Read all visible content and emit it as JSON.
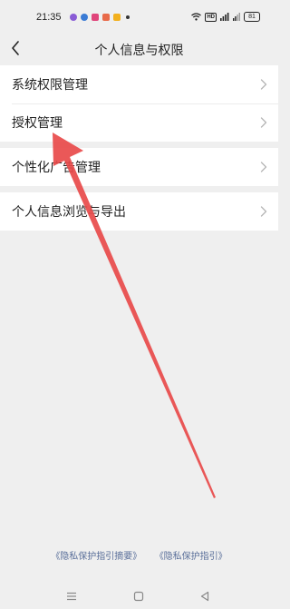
{
  "status_bar": {
    "time": "21:35",
    "hd_label": "HD",
    "battery": "81"
  },
  "header": {
    "title": "个人信息与权限"
  },
  "menu": {
    "items": [
      {
        "label": "系统权限管理"
      },
      {
        "label": "授权管理"
      },
      {
        "label": "个性化广告管理"
      },
      {
        "label": "个人信息浏览与导出"
      }
    ]
  },
  "footer": {
    "link1": "《隐私保护指引摘要》",
    "link2": "《隐私保护指引》"
  },
  "colors": {
    "background": "#efefef",
    "card": "#ffffff",
    "link": "#5a6f9a",
    "annotation_arrow": "#e84a4a"
  },
  "icons": {
    "back": "chevron-left-icon",
    "row_arrow": "chevron-right-icon",
    "nav_menu": "menu-icon",
    "nav_home": "square-icon",
    "nav_back": "triangle-back-icon"
  }
}
